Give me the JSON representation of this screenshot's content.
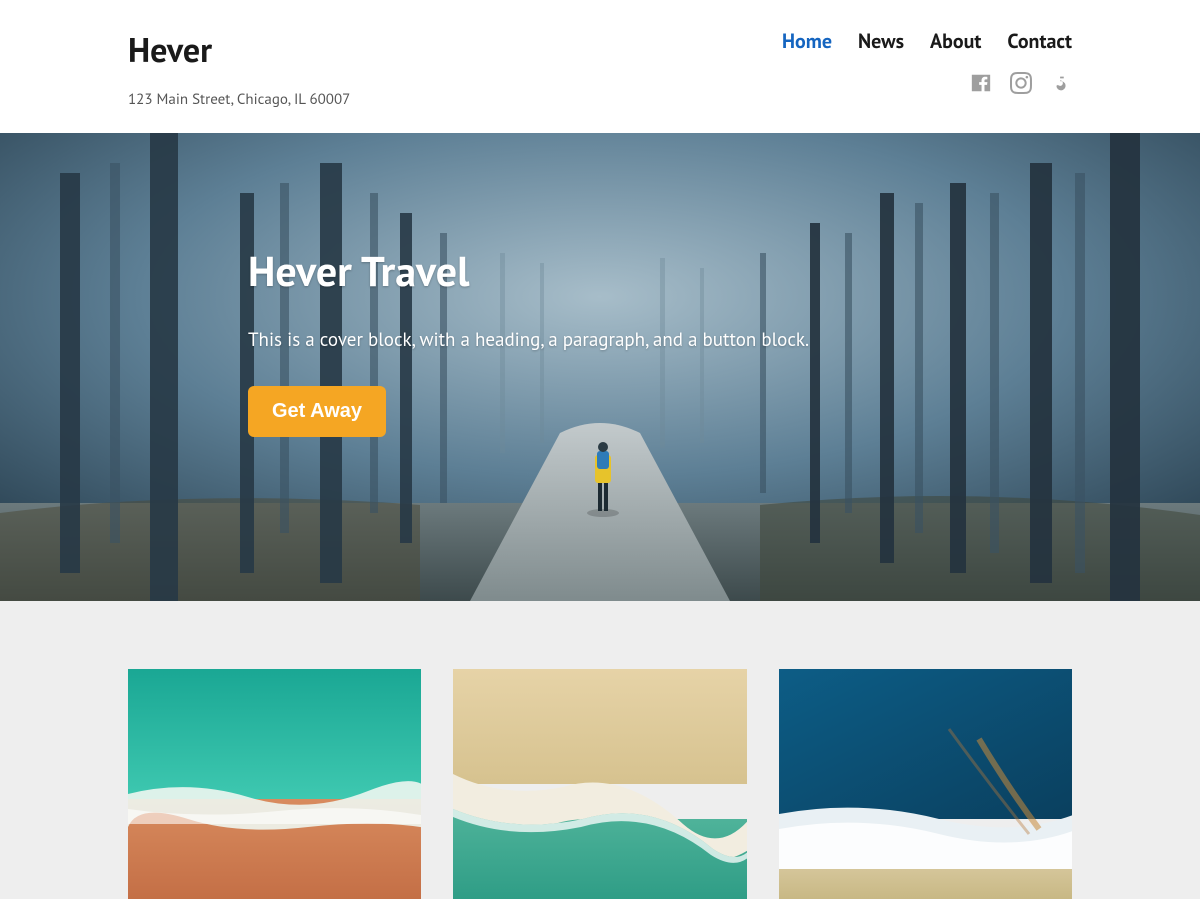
{
  "site": {
    "title": "Hever",
    "tagline": "123 Main Street, Chicago, IL 60007"
  },
  "nav": {
    "items": [
      {
        "label": "Home",
        "active": true
      },
      {
        "label": "News",
        "active": false
      },
      {
        "label": "About",
        "active": false
      },
      {
        "label": "Contact",
        "active": false
      }
    ]
  },
  "socials": {
    "items": [
      "facebook",
      "instagram",
      "fivehundredpx"
    ]
  },
  "hero": {
    "title": "Hever Travel",
    "subtitle": "This is a cover block, with a heading, a paragraph, and a button block.",
    "cta_label": "Get Away"
  },
  "cards": {
    "count": 3
  },
  "colors": {
    "accent": "#1565c0",
    "cta": "#f5a623",
    "band_bg": "#eeeeee"
  }
}
